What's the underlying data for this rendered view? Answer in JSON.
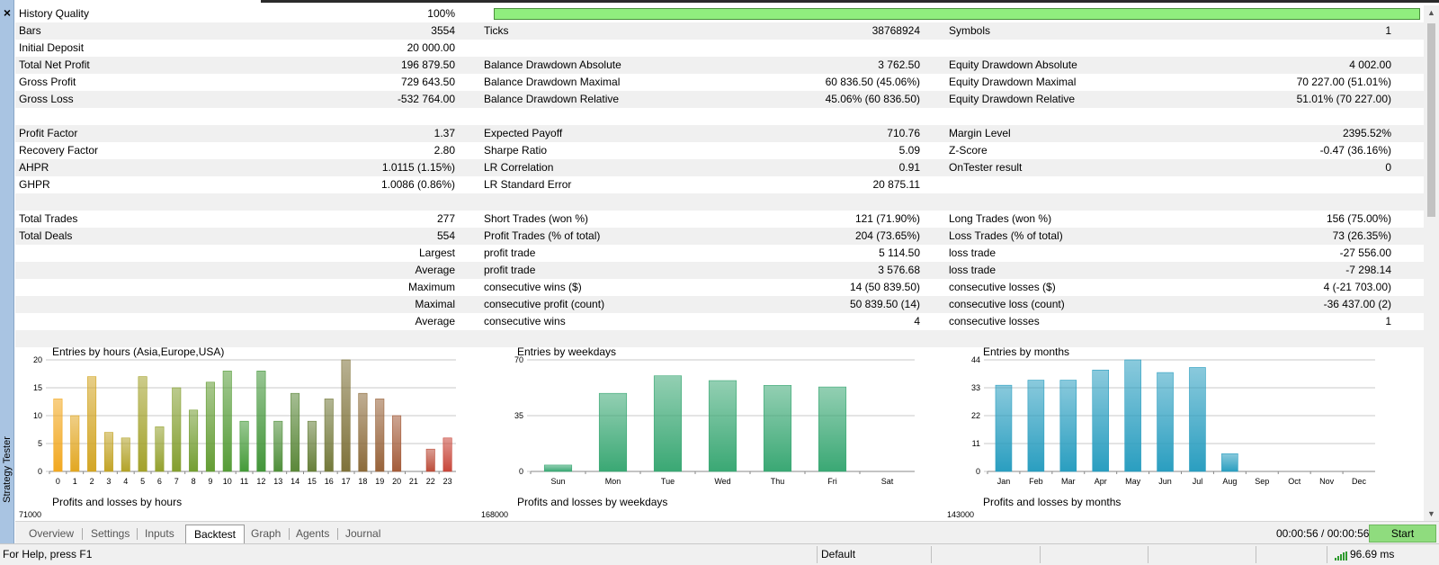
{
  "sidebar": {
    "close_icon": "×",
    "title": "Strategy Tester"
  },
  "colors": {
    "quality_bar": "#90ee7e",
    "hours_gradient": [
      "#f2a820",
      "#3d9a3a",
      "#c8463a"
    ],
    "weekdays_bar": "#3aa874",
    "months_bar": "#2a9ec0",
    "start_button": "#8fdc7e"
  },
  "stats": {
    "history_quality": {
      "label": "History Quality",
      "value": "100%",
      "fill_percent": 100
    },
    "bars": {
      "label": "Bars",
      "value": "3554"
    },
    "ticks": {
      "label": "Ticks",
      "value": "38768924"
    },
    "symbols": {
      "label": "Symbols",
      "value": "1"
    },
    "initial_deposit": {
      "label": "Initial Deposit",
      "value": "20 000.00"
    },
    "total_net_profit": {
      "label": "Total Net Profit",
      "value": "196 879.50"
    },
    "balance_dd_abs": {
      "label": "Balance Drawdown Absolute",
      "value": "3 762.50"
    },
    "equity_dd_abs": {
      "label": "Equity Drawdown Absolute",
      "value": "4 002.00"
    },
    "gross_profit": {
      "label": "Gross Profit",
      "value": "729 643.50"
    },
    "balance_dd_max": {
      "label": "Balance Drawdown Maximal",
      "value": "60 836.50 (45.06%)"
    },
    "equity_dd_max": {
      "label": "Equity Drawdown Maximal",
      "value": "70 227.00 (51.01%)"
    },
    "gross_loss": {
      "label": "Gross Loss",
      "value": "-532 764.00"
    },
    "balance_dd_rel": {
      "label": "Balance Drawdown Relative",
      "value": "45.06% (60 836.50)"
    },
    "equity_dd_rel": {
      "label": "Equity Drawdown Relative",
      "value": "51.01% (70 227.00)"
    },
    "profit_factor": {
      "label": "Profit Factor",
      "value": "1.37"
    },
    "expected_payoff": {
      "label": "Expected Payoff",
      "value": "710.76"
    },
    "margin_level": {
      "label": "Margin Level",
      "value": "2395.52%"
    },
    "recovery_factor": {
      "label": "Recovery Factor",
      "value": "2.80"
    },
    "sharpe_ratio": {
      "label": "Sharpe Ratio",
      "value": "5.09"
    },
    "z_score": {
      "label": "Z-Score",
      "value": "-0.47 (36.16%)"
    },
    "ahpr": {
      "label": "AHPR",
      "value": "1.0115 (1.15%)"
    },
    "lr_correlation": {
      "label": "LR Correlation",
      "value": "0.91"
    },
    "ontester": {
      "label": "OnTester result",
      "value": "0"
    },
    "ghpr": {
      "label": "GHPR",
      "value": "1.0086 (0.86%)"
    },
    "lr_std_error": {
      "label": "LR Standard Error",
      "value": "20 875.11"
    },
    "total_trades": {
      "label": "Total Trades",
      "value": "277"
    },
    "short_trades": {
      "label": "Short Trades (won %)",
      "value": "121 (71.90%)"
    },
    "long_trades": {
      "label": "Long Trades (won %)",
      "value": "156 (75.00%)"
    },
    "total_deals": {
      "label": "Total Deals",
      "value": "554"
    },
    "profit_trades": {
      "label": "Profit Trades (% of total)",
      "value": "204 (73.65%)"
    },
    "loss_trades": {
      "label": "Loss Trades (% of total)",
      "value": "73 (26.35%)"
    },
    "largest": {
      "label": "Largest",
      "p_label": "profit trade",
      "p_value": "5 114.50",
      "l_label": "loss trade",
      "l_value": "-27 556.00"
    },
    "average": {
      "label": "Average",
      "p_label": "profit trade",
      "p_value": "3 576.68",
      "l_label": "loss trade",
      "l_value": "-7 298.14"
    },
    "maximum": {
      "label": "Maximum",
      "p_label": "consecutive wins ($)",
      "p_value": "14 (50 839.50)",
      "l_label": "consecutive losses ($)",
      "l_value": "4 (-21 703.00)"
    },
    "maximal": {
      "label": "Maximal",
      "p_label": "consecutive profit (count)",
      "p_value": "50 839.50 (14)",
      "l_label": "consecutive loss (count)",
      "l_value": "-36 437.00 (2)"
    },
    "average2": {
      "label": "Average",
      "p_label": "consecutive wins",
      "p_value": "4",
      "l_label": "consecutive losses",
      "l_value": "1"
    }
  },
  "chart_data": [
    {
      "type": "bar",
      "title": "Entries by hours (Asia,Europe,USA)",
      "categories": [
        "0",
        "1",
        "2",
        "3",
        "4",
        "5",
        "6",
        "7",
        "8",
        "9",
        "10",
        "11",
        "12",
        "13",
        "14",
        "15",
        "16",
        "17",
        "18",
        "19",
        "20",
        "21",
        "22",
        "23"
      ],
      "values": [
        13,
        10,
        17,
        7,
        6,
        17,
        8,
        15,
        11,
        16,
        18,
        9,
        18,
        9,
        14,
        9,
        13,
        20,
        14,
        13,
        10,
        0,
        4,
        6
      ],
      "yticks": [
        "0",
        "5",
        "10",
        "15",
        "20"
      ],
      "ylim": [
        0,
        20
      ],
      "grid": true
    },
    {
      "type": "bar",
      "title": "Entries by weekdays",
      "categories": [
        "Sun",
        "Mon",
        "Tue",
        "Wed",
        "Thu",
        "Fri",
        "Sat"
      ],
      "values": [
        4,
        49,
        60,
        57,
        54,
        53,
        0
      ],
      "yticks": [
        "0",
        "35",
        "70"
      ],
      "ylim": [
        0,
        70
      ],
      "grid": true
    },
    {
      "type": "bar",
      "title": "Entries by months",
      "categories": [
        "Jan",
        "Feb",
        "Mar",
        "Apr",
        "May",
        "Jun",
        "Jul",
        "Aug",
        "Sep",
        "Oct",
        "Nov",
        "Dec"
      ],
      "values": [
        34,
        36,
        36,
        40,
        44,
        39,
        41,
        7,
        0,
        0,
        0,
        0
      ],
      "yticks": [
        "0",
        "11",
        "22",
        "33",
        "44"
      ],
      "ylim": [
        0,
        44
      ],
      "grid": true
    }
  ],
  "bottom_charts": [
    {
      "title": "Profits and losses by hours",
      "top_tick": "71000"
    },
    {
      "title": "Profits and losses by weekdays",
      "top_tick": "168000"
    },
    {
      "title": "Profits and losses by months",
      "top_tick": "143000"
    }
  ],
  "tabs": [
    {
      "label": "Overview",
      "active": false
    },
    {
      "label": "Settings",
      "active": false
    },
    {
      "label": "Inputs",
      "active": false
    },
    {
      "label": "Backtest",
      "active": true
    },
    {
      "label": "Graph",
      "active": false
    },
    {
      "label": "Agents",
      "active": false
    },
    {
      "label": "Journal",
      "active": false
    }
  ],
  "timer": "00:00:56 / 00:00:56",
  "start_label": "Start",
  "status": {
    "help": "For Help, press F1",
    "profile": "Default",
    "ping": "96.69 ms"
  }
}
